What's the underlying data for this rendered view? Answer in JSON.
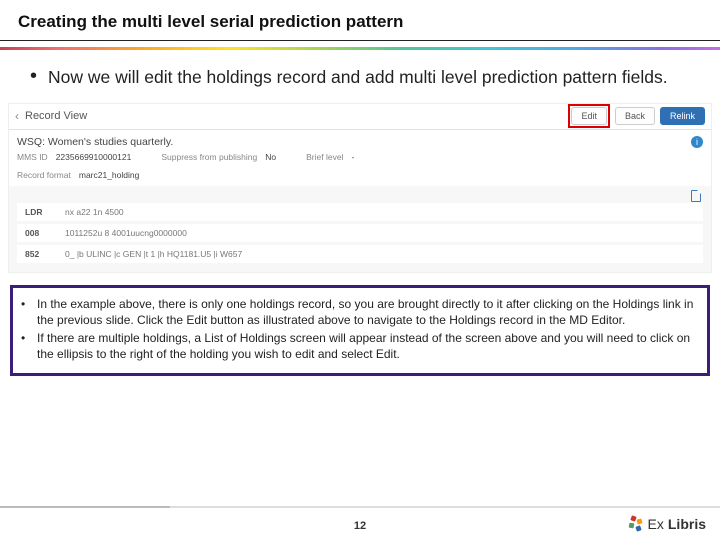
{
  "title": "Creating the multi level serial prediction pattern",
  "main_bullet": "Now we will edit the holdings record and add multi level prediction pattern fields.",
  "screenshot": {
    "record_view_label": "Record View",
    "buttons": {
      "edit": "Edit",
      "back": "Back",
      "relink": "Relink"
    },
    "record_title": "WSQ: Women's studies quarterly.",
    "meta": {
      "mmsid_label": "MMS ID",
      "mmsid_value": "2235669910000121",
      "suppress_label": "Suppress from publishing",
      "suppress_value": "No",
      "brief_label": "Brief level",
      "brief_value": "-",
      "recfmt_label": "Record format",
      "recfmt_value": "marc21_holding"
    },
    "marc": {
      "ldr_tag": "LDR",
      "ldr_val": "nx a22 1n 4500",
      "f008_tag": "008",
      "f008_val": "1011252u 8 4001uucng0000000",
      "f852_tag": "852",
      "f852_val": "0_ |b ULINC |c GEN |t 1 |h HQ1181.U5 |i W657"
    }
  },
  "notes": {
    "n1": "In the example above, there is only one holdings record, so you are brought directly to it after clicking on the Holdings link in the previous slide. Click the Edit button as illustrated above to navigate to the Holdings record in the MD Editor.",
    "n2": "If there are multiple holdings, a List of Holdings screen will appear instead of the screen above and you will need to click on the ellipsis to the right of the holding you wish to edit and select Edit."
  },
  "page_number": "12",
  "logo": {
    "ex": "Ex",
    "libris": "Libris"
  }
}
